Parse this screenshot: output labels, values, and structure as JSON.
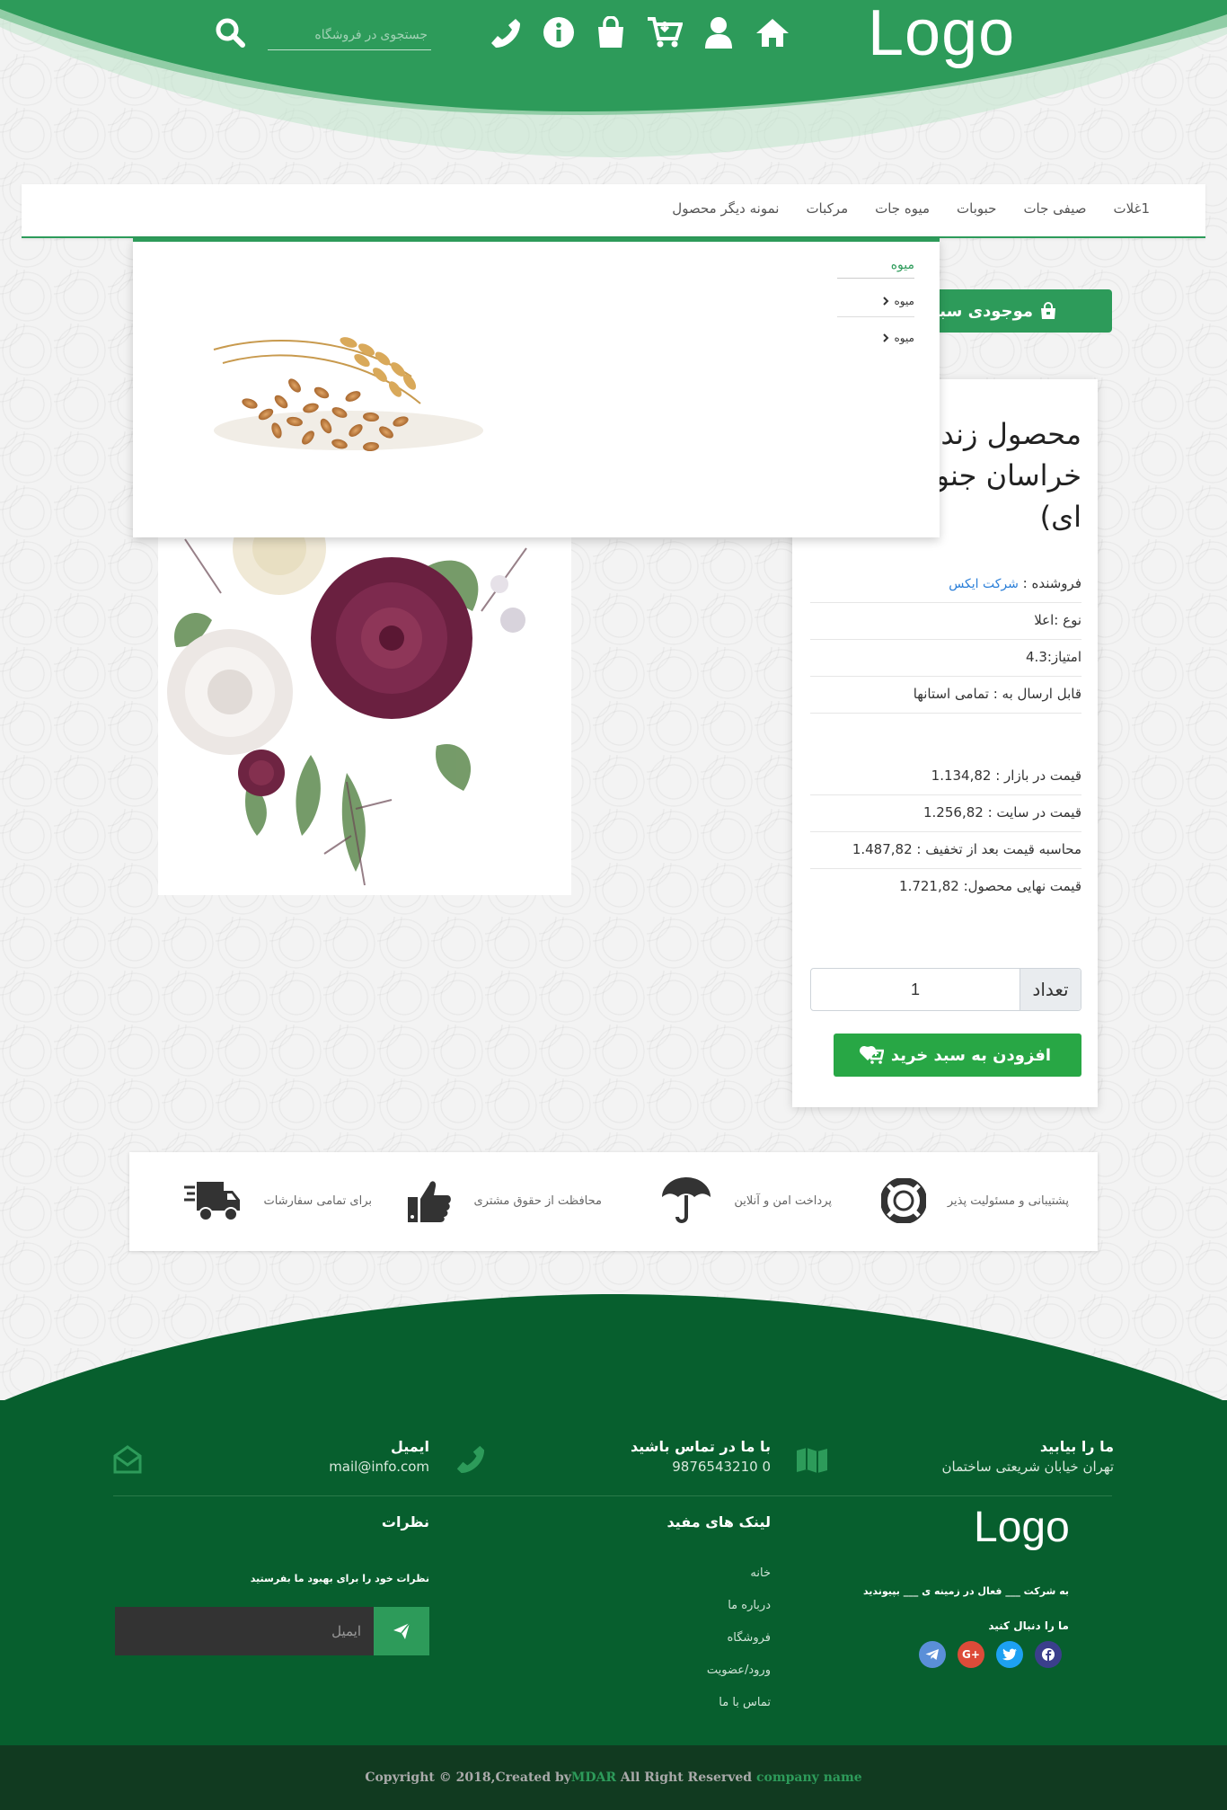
{
  "header": {
    "logo": "Logo",
    "search_placeholder": "جستجوی در فروشگاه",
    "icons": [
      "home-icon",
      "user-icon",
      "cart-download-icon",
      "shopping-bag-icon",
      "info-icon",
      "phone-icon",
      "search-icon"
    ]
  },
  "nav": {
    "items": [
      "غلات",
      "صیفی جات",
      "حبوبات",
      "میوه جات",
      "مرکبات",
      "نمونه دیگر محصول"
    ],
    "first_item_suffix": "1"
  },
  "mega_menu": {
    "title": "میوه",
    "items": [
      "میوه",
      "میوه"
    ]
  },
  "product": {
    "title_line1": "محصول زند",
    "title_line2": "خراسان جنو",
    "title_line3": "ای)",
    "stock_button": "موجودی سبد",
    "seller_label": "فروشنده : ",
    "seller_link": "شرکت ایکس",
    "type": "نوع :اعلا",
    "rating": "امتیاز:4.3",
    "shipping": "قابل ارسال به : تمامی استانها",
    "market_price": "قیمت در بازار : 1.134,82",
    "site_price": "قیمت در سایت : 1.256,82",
    "discount_price": "محاسبه قیمت بعد از تخفیف : 1.487,82",
    "final_price": "قیمت نهایی محصول: 1.721,82",
    "quantity_label": "تعداد",
    "quantity_value": "1",
    "add_to_cart": "افزودن به سبد خرید"
  },
  "features": [
    {
      "text": "پشتیبانی و مسئولیت پذیر",
      "icon": "lifebuoy-icon"
    },
    {
      "text": "پرداخت امن و آنلاین",
      "icon": "umbrella-icon"
    },
    {
      "text": "محافظت از حقوق مشتری",
      "icon": "thumbs-up-icon"
    },
    {
      "text": "برای تمامی سفارشات",
      "icon": "fast-delivery-truck-icon"
    }
  ],
  "footer": {
    "find_us_title": "ما را بیابید",
    "find_us_text": "تهران خیابان شریعتی ساختمان",
    "contact_title": "با ما در تماس باشید",
    "contact_phone": "0 9876543210",
    "email_title": "ایمیل",
    "email_value": "mail@info.com",
    "logo": "Logo",
    "about_text": "به شرکت ___ فعال در زمینه ی ___ بپیوندید",
    "follow_text": "ما را دنبال کنید",
    "links_title": "لینک های مفید",
    "links": [
      "خانه",
      "درباره ما",
      "فروشگاه",
      "ورود/عضویت",
      "تماس با ما"
    ],
    "comments_title": "نظرات",
    "comments_text": "نظرات خود را برای بهبود ما بفرستید",
    "email_placeholder": "ایمیل",
    "social_colors": {
      "facebook": "#3b3f8c",
      "twitter": "#1da1f2",
      "google": "#dd4b39",
      "telegram": "#5a8fd8"
    }
  },
  "copyright": {
    "prefix": "Copyright © 2018,Created by ",
    "author": "MDAR",
    "middle": " All Right Reserved ",
    "company": "company name"
  },
  "colors": {
    "primary": "#2d9b5a",
    "footer": "#075f2e",
    "button": "#28a745"
  }
}
